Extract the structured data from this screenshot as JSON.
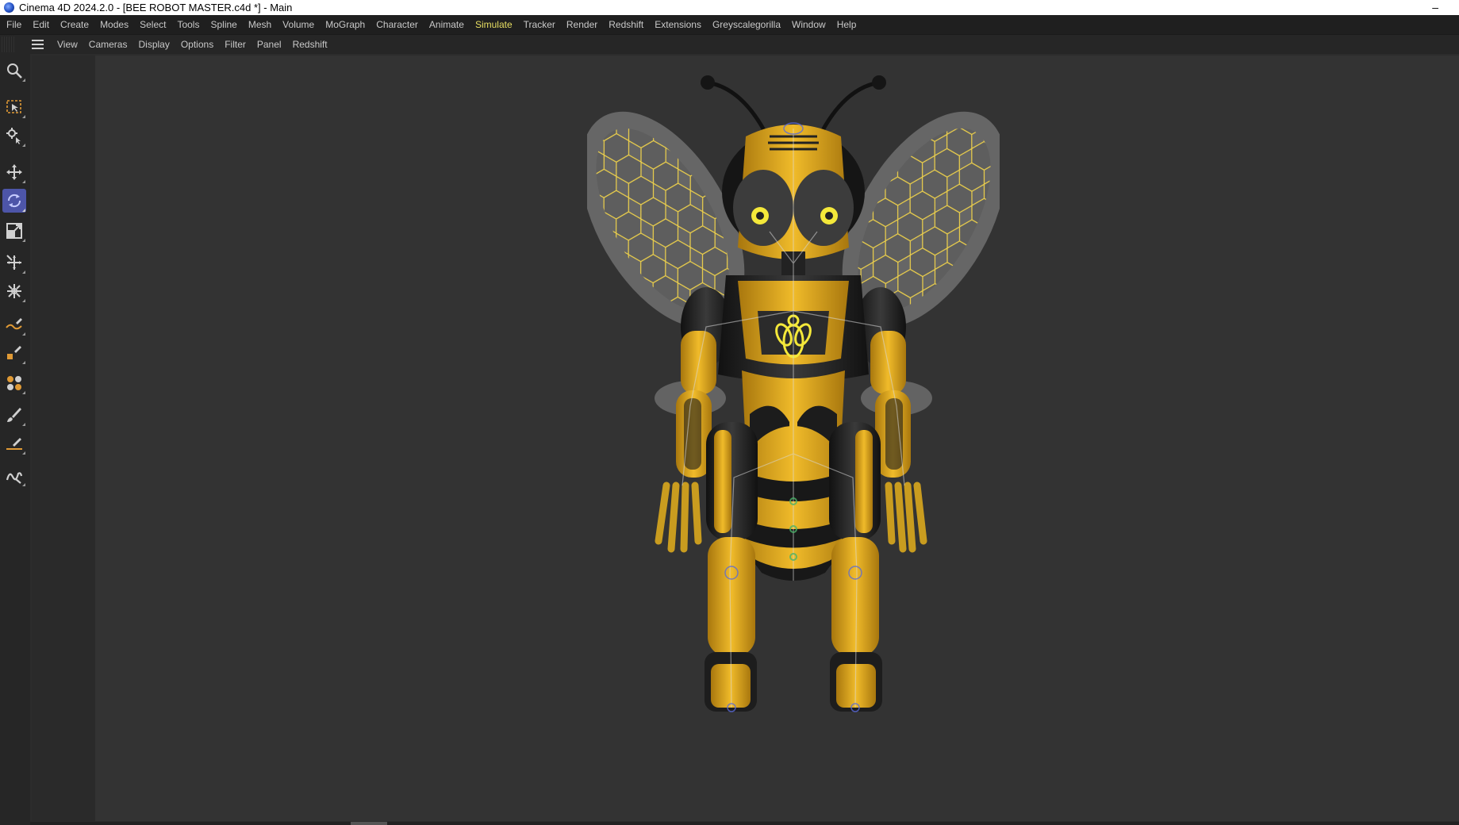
{
  "window": {
    "title": "Cinema 4D 2024.2.0 - [BEE ROBOT MASTER.c4d *] - Main",
    "app_icon": "cinema4d-logo-icon",
    "minimize_glyph": "–"
  },
  "menubar": {
    "items": [
      "File",
      "Edit",
      "Create",
      "Modes",
      "Select",
      "Tools",
      "Spline",
      "Mesh",
      "Volume",
      "MoGraph",
      "Character",
      "Animate",
      "Simulate",
      "Tracker",
      "Render",
      "Redshift",
      "Extensions",
      "Greyscalegorilla",
      "Window",
      "Help"
    ],
    "active_item": "Simulate",
    "active_color": "#e8df62"
  },
  "viewport_menu": {
    "items": [
      "View",
      "Cameras",
      "Display",
      "Options",
      "Filter",
      "Panel",
      "Redshift"
    ],
    "menu_icon": "hamburger-icon"
  },
  "toolbar": {
    "tools": [
      {
        "name": "search-icon",
        "selected": false
      },
      {
        "name": "box-selection-icon",
        "selected": false
      },
      {
        "name": "tweak-mode-icon",
        "selected": false
      },
      {
        "name": "move-icon",
        "selected": false
      },
      {
        "name": "rotate-icon",
        "selected": true
      },
      {
        "name": "scale-icon",
        "selected": false
      },
      {
        "name": "transform-icon",
        "selected": false
      },
      {
        "name": "snap-transform-icon",
        "selected": false
      },
      {
        "name": "spline-pen-icon",
        "selected": false
      },
      {
        "name": "primitive-pen-icon",
        "selected": false
      },
      {
        "name": "mograph-cloner-icon",
        "selected": false
      },
      {
        "name": "paint-brush-icon",
        "selected": false
      },
      {
        "name": "knife-line-icon",
        "selected": false
      },
      {
        "name": "sketch-tool-icon",
        "selected": false
      }
    ],
    "selected_color": "#4d55a8"
  },
  "viewport": {
    "object": "bee-robot-model",
    "colors": {
      "body_yellow": "#e0a81c",
      "body_black": "#1c1c1c",
      "wing_grey": "#6a6a6a",
      "eye_yellow": "#f4e83a"
    }
  }
}
